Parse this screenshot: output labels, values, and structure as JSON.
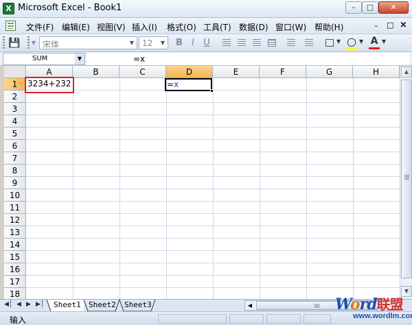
{
  "window": {
    "title": "Microsoft Excel - Book1",
    "min": "–",
    "max": "□",
    "close": "✕"
  },
  "menu": {
    "items": [
      "文件(F)",
      "编辑(E)",
      "视图(V)",
      "插入(I)",
      "格式(O)",
      "工具(T)",
      "数据(D)",
      "窗口(W)",
      "帮助(H)"
    ],
    "right": {
      "min": "–",
      "max": "□",
      "close": "×"
    }
  },
  "toolbar": {
    "font_name": "宋体",
    "font_size": "12",
    "bold": "B",
    "italic": "I",
    "underline": "U",
    "font_color_glyph": "A",
    "fill_color": "#ffff00",
    "font_color": "#e02020"
  },
  "formula_bar": {
    "name_box": "SUM",
    "formula": "=x"
  },
  "grid": {
    "columns": [
      "A",
      "B",
      "C",
      "D",
      "E",
      "F",
      "G",
      "H"
    ],
    "active_column": "D",
    "rows": [
      "1",
      "2",
      "3",
      "4",
      "5",
      "6",
      "7",
      "8",
      "9",
      "10",
      "11",
      "12",
      "13",
      "14",
      "15",
      "16",
      "17",
      "18"
    ],
    "active_row": "1",
    "cells": {
      "A1": "3234+232",
      "D1_eq": "=",
      "D1_ref": "x"
    },
    "highlight_color": "#e01e26"
  },
  "sheets": {
    "tabs": [
      "Sheet1",
      "Sheet2",
      "Sheet3"
    ],
    "active": "Sheet1"
  },
  "status": {
    "mode": "输入"
  },
  "watermark": {
    "w": "W",
    "o": "o",
    "rd": "rd",
    "cn": "联盟",
    "url": "www.wordlm.com"
  }
}
